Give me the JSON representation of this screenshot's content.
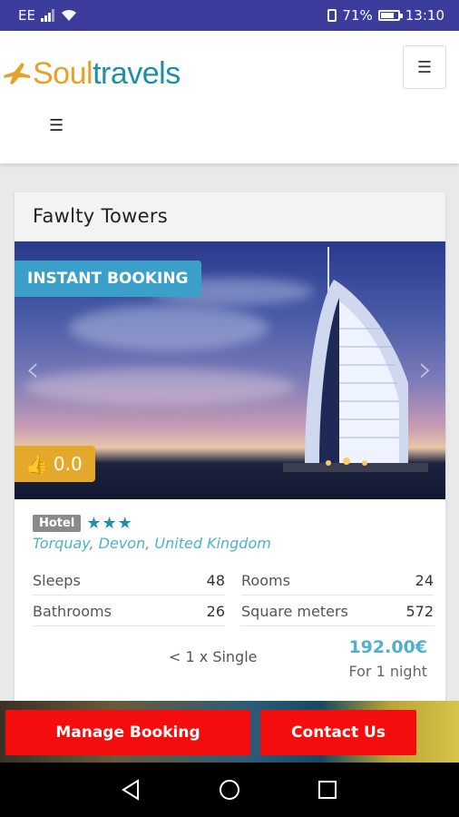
{
  "status_bar": {
    "carrier": "EE",
    "battery_percent": "71%",
    "time": "13:10",
    "battery_level": 0.71
  },
  "header": {
    "logo_soul": "Soul",
    "logo_travels": "travels",
    "menu_icon": "hamburger-icon"
  },
  "listing": {
    "title": "Fawlty Towers",
    "instant_badge": "INSTANT BOOKING",
    "rating": "0.0",
    "type": "Hotel",
    "stars": "★★★",
    "star_count": 3,
    "location": {
      "town": "Torquay",
      "county": "Devon",
      "country": "United Kingdom"
    },
    "facts": [
      {
        "label": "Sleeps",
        "value": "48"
      },
      {
        "label": "Rooms",
        "value": "24"
      },
      {
        "label": "Bathrooms",
        "value": "26"
      },
      {
        "label": "Square meters",
        "value": "572"
      }
    ],
    "room": "< 1 x Single",
    "price": "192.00€",
    "price_note": "For 1 night"
  },
  "actions": {
    "manage": "Manage Booking",
    "contact": "Contact Us"
  },
  "colors": {
    "accent": "#1f8fa8",
    "brand_orange": "#e7a127",
    "button_red": "#f40d0d",
    "status_bar": "#3c3c9c"
  }
}
